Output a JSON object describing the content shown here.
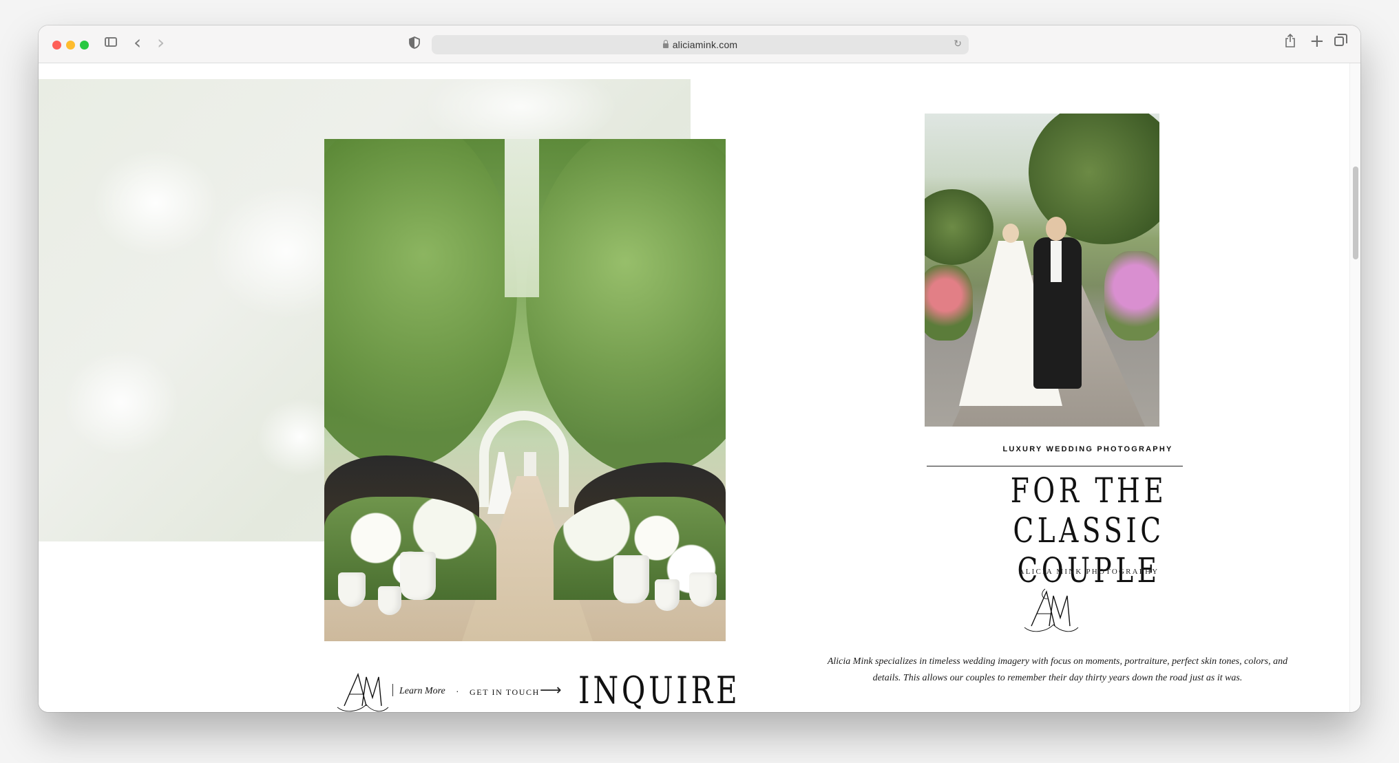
{
  "browser": {
    "url": "aliciamink.com",
    "icons": {
      "sidebar": "sidebar-icon",
      "back": "chevron-left-icon",
      "forward": "chevron-right-icon",
      "privacy": "shield-icon",
      "lock": "lock-icon",
      "reload": "reload-icon",
      "share": "share-icon",
      "new_tab": "plus-icon",
      "tabs": "tabs-overview-icon"
    },
    "glyphs": {
      "back": "‹",
      "forward": "›",
      "reload": "↻",
      "new_tab": "+"
    }
  },
  "page": {
    "kicker": "LUXURY WEDDING PHOTOGRAPHY",
    "headline_line1": "FOR THE",
    "headline_line2": "CLASSIC COUPLE",
    "subkicker": "ALICIA MINK PHOTOGRAPHY",
    "blurb": "Alicia Mink specializes in timeless wedding imagery with focus on moments, portraiture, perfect skin tones, colors, and details. This allows our couples to remember their day thirty years down the road just as it was.",
    "monogram": "AM"
  },
  "cta": {
    "learn_more": "Learn More",
    "separator": "·",
    "get_in_touch": "GET IN TOUCH",
    "arrow": "⟶",
    "inquire": "INQUIRE"
  },
  "colors": {
    "text": "#111111",
    "toolbar": "#f6f5f5",
    "url_bar": "#e5e5e5",
    "traffic_red": "#fe5f57",
    "traffic_yellow": "#febc2e",
    "traffic_green": "#28c840"
  }
}
